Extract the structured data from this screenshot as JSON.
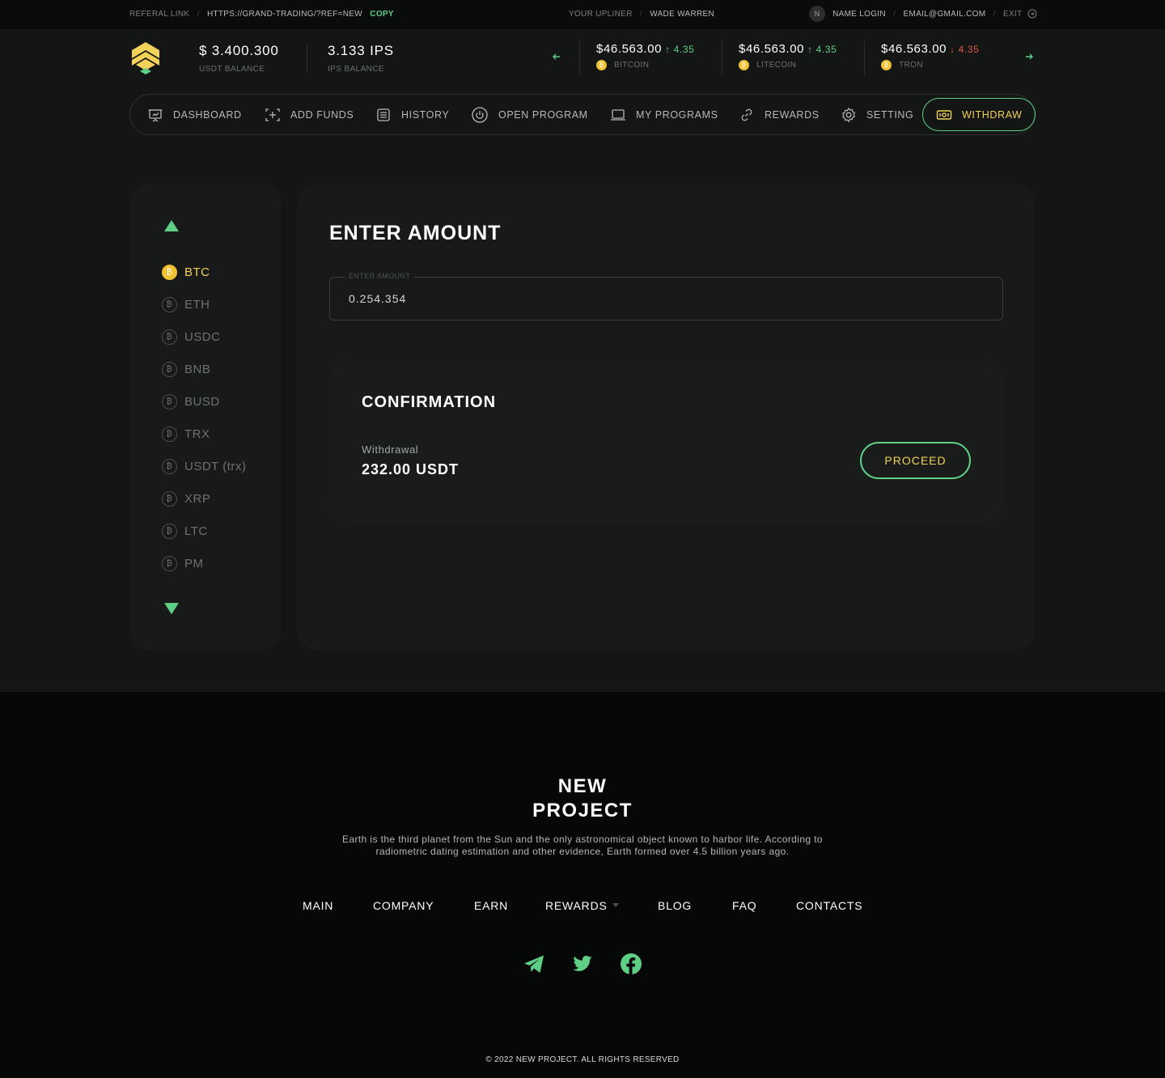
{
  "topbar": {
    "referral_label": "REFERAL LINK",
    "referral_url": "HTTPS://GRAND-TRADING/?REF=NEW",
    "copy_label": "COPY",
    "upliner_label": "YOUR UPLINER",
    "upliner_name": "WADE WARREN",
    "avatar_initial": "N",
    "name_login": "NAME LOGIN",
    "email": "EMAIL@GMAIL.COM",
    "exit_label": "EXIT"
  },
  "balances": {
    "usdt_value": "$ 3.400.300",
    "usdt_label": "USDT BALANCE",
    "ips_value": "3.133 IPS",
    "ips_label": "IPS BALANCE"
  },
  "tickers": [
    {
      "price": "$46.563.00",
      "change": "4.35",
      "direction": "up",
      "name": "BITCOIN"
    },
    {
      "price": "$46.563.00",
      "change": "4.35",
      "direction": "up",
      "name": "LITECOIN"
    },
    {
      "price": "$46.563.00",
      "change": "4.35",
      "direction": "down",
      "name": "TRON"
    }
  ],
  "nav": {
    "items": [
      {
        "label": "DASHBOARD",
        "icon": "presentation-icon"
      },
      {
        "label": "ADD FUNDS",
        "icon": "add-funds-icon"
      },
      {
        "label": "HISTORY",
        "icon": "list-icon"
      },
      {
        "label": "OPEN PROGRAM",
        "icon": "power-icon"
      },
      {
        "label": "MY PROGRAMS",
        "icon": "laptop-icon"
      },
      {
        "label": "REWARDS",
        "icon": "link-icon"
      },
      {
        "label": "SETTING",
        "icon": "gear-icon"
      },
      {
        "label": "WITHDRAW",
        "icon": "cash-icon",
        "active": true
      }
    ]
  },
  "coins": {
    "items": [
      {
        "label": "BTC",
        "active": true
      },
      {
        "label": "ETH"
      },
      {
        "label": "USDC"
      },
      {
        "label": "BNB"
      },
      {
        "label": "BUSD"
      },
      {
        "label": "TRX"
      },
      {
        "label": "USDT (trx)"
      },
      {
        "label": "XRP"
      },
      {
        "label": "LTC"
      },
      {
        "label": "PM"
      }
    ]
  },
  "main": {
    "title": "ENTER AMOUNT",
    "amount_legend": "ENTER AMOUNT",
    "amount_value": "0.254.354",
    "confirmation": {
      "title": "CONFIRMATION",
      "withdrawal_label": "Withdrawal",
      "withdrawal_value": "232.00 USDT",
      "proceed_label": "PROCEED"
    }
  },
  "footer": {
    "title_line1": "NEW",
    "title_line2": "PROJECT",
    "description": "Earth is the third planet from the Sun and the only astronomical object known to harbor life. According to radiometric dating estimation and other evidence, Earth formed over 4.5 billion years ago.",
    "nav": [
      "MAIN",
      "COMPANY",
      "EARN",
      "REWARDS",
      "BLOG",
      "FAQ",
      "CONTACTS"
    ],
    "social": [
      "telegram-icon",
      "twitter-icon",
      "facebook-icon"
    ],
    "copyright": "© 2022 NEW PROJECT. ALL RIGHTS RESERVED"
  },
  "colors": {
    "accent_green": "#5fcf86",
    "accent_yellow": "#f3d25a",
    "down_red": "#e0564a",
    "coin_gold": "#f1c231"
  }
}
